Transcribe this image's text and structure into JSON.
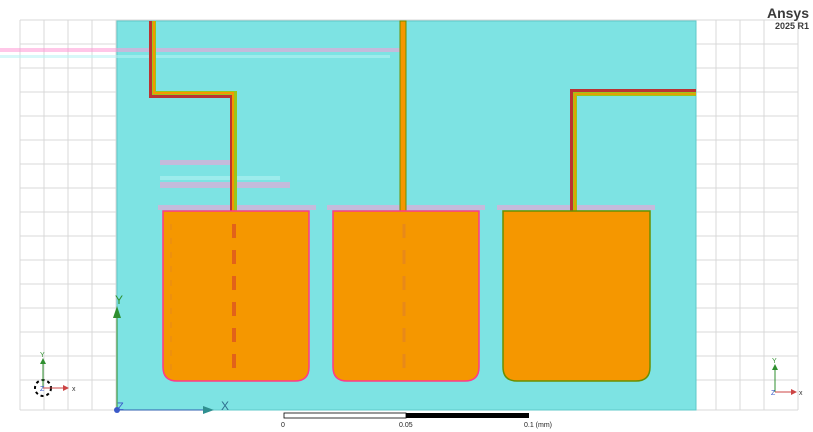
{
  "app": {
    "brand": "Ansys",
    "version": "2025 R1"
  },
  "axes": {
    "main_x": "X",
    "main_y": "Y",
    "main_z": "Z",
    "triad_x": "x",
    "triad_y": "Y",
    "triad_z": "Z"
  },
  "scale_bar": {
    "labels": [
      "0",
      "0.05",
      "0.1 (mm)"
    ]
  },
  "colors": {
    "substrate": "#7de3e3",
    "copper": "#f59700",
    "trace": "#9cc51a",
    "grid": "#d6d6d6"
  }
}
